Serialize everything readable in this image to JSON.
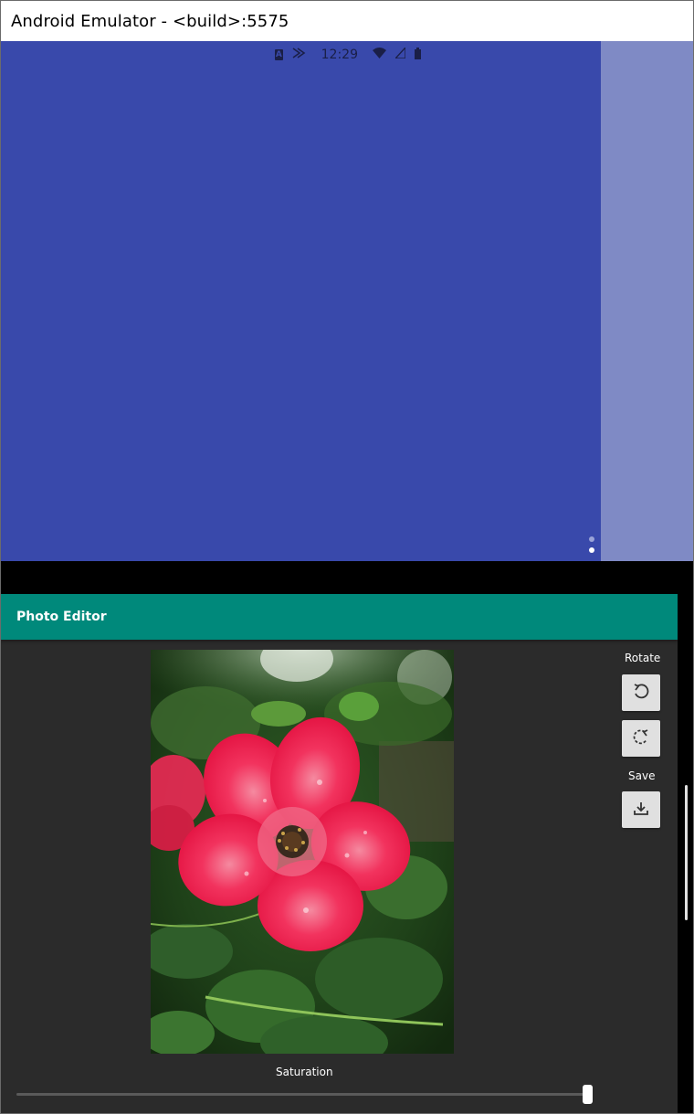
{
  "window": {
    "title": "Android Emulator - <build>:5575"
  },
  "status_bar": {
    "time": "12:29",
    "icons": [
      "a-notification-icon",
      "cast-icon",
      "wifi-icon",
      "signal-icon",
      "battery-icon"
    ]
  },
  "app": {
    "title": "Photo Editor",
    "rotate_label": "Rotate",
    "save_label": "Save",
    "saturation_label": "Saturation",
    "saturation_value": 1.0,
    "photo_subject": "pink rose with raindrops on green leaves"
  },
  "colors": {
    "top_screen": "#3949ab",
    "top_right_pane": "#7f8ac5",
    "app_bar": "#00897b",
    "app_background": "#2b2b2b",
    "button": "#e0e0e0"
  }
}
